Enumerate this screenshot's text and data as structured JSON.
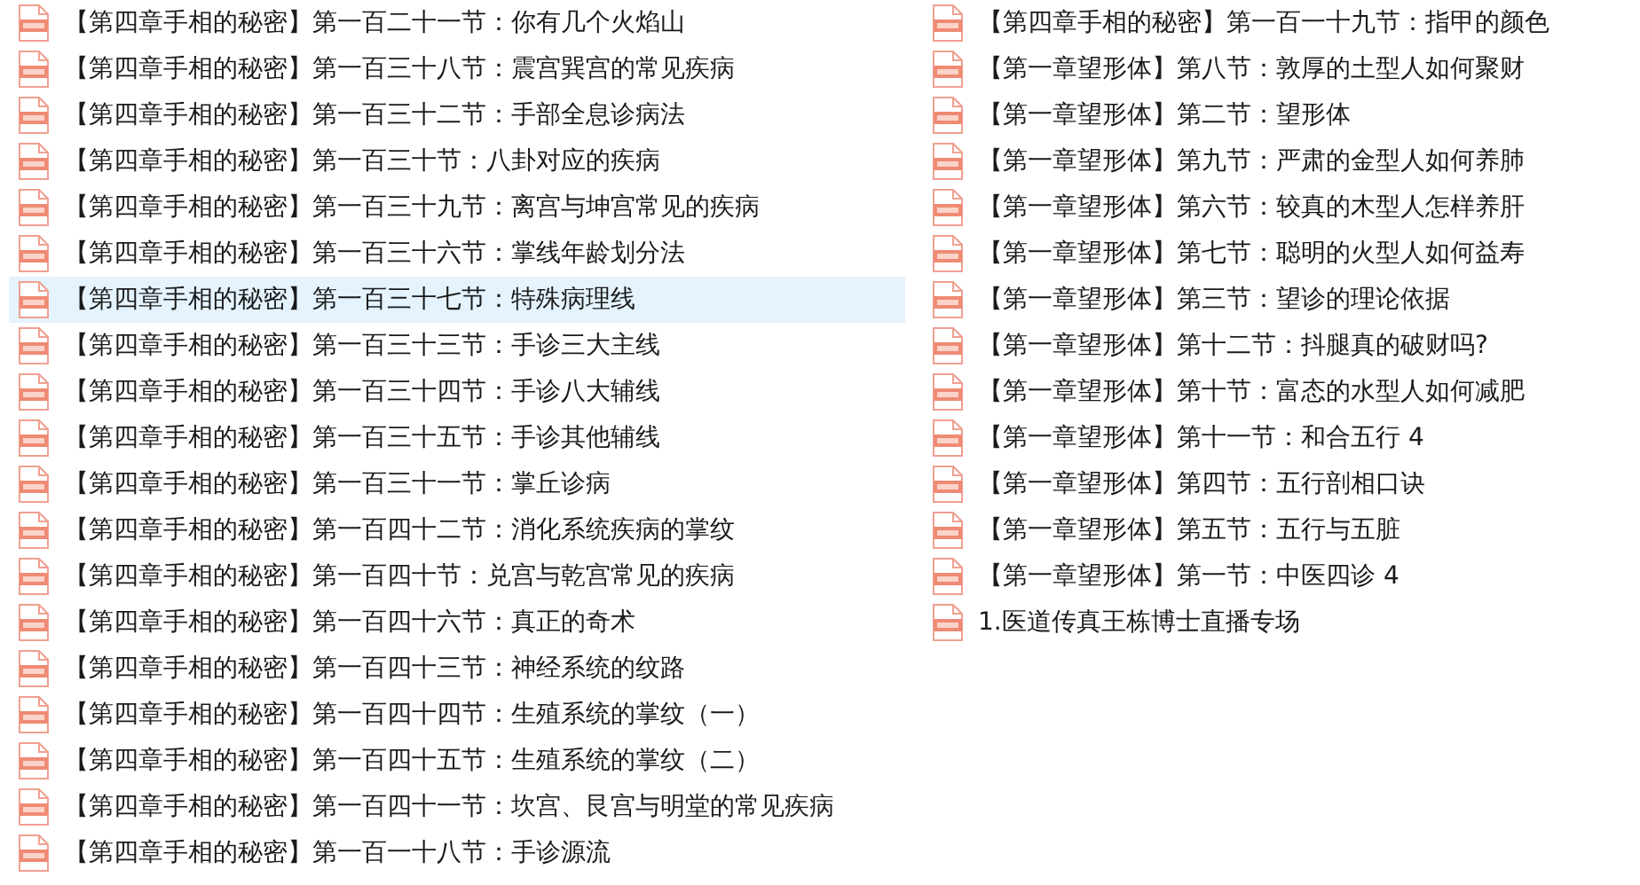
{
  "columns": [
    {
      "files": [
        {
          "name": "【第四章手相的秘密】第一百二十一节：你有几个火焰山",
          "selected": false
        },
        {
          "name": "【第四章手相的秘密】第一百三十八节：震宫巽宫的常见疾病",
          "selected": false
        },
        {
          "name": "【第四章手相的秘密】第一百三十二节：手部全息诊病法",
          "selected": false
        },
        {
          "name": "【第四章手相的秘密】第一百三十节：八卦对应的疾病",
          "selected": false
        },
        {
          "name": "【第四章手相的秘密】第一百三十九节：离宫与坤宫常见的疾病",
          "selected": false
        },
        {
          "name": "【第四章手相的秘密】第一百三十六节：掌线年龄划分法",
          "selected": false
        },
        {
          "name": "【第四章手相的秘密】第一百三十七节：特殊病理线",
          "selected": true
        },
        {
          "name": "【第四章手相的秘密】第一百三十三节：手诊三大主线",
          "selected": false
        },
        {
          "name": "【第四章手相的秘密】第一百三十四节：手诊八大辅线",
          "selected": false
        },
        {
          "name": "【第四章手相的秘密】第一百三十五节：手诊其他辅线",
          "selected": false
        },
        {
          "name": "【第四章手相的秘密】第一百三十一节：掌丘诊病",
          "selected": false
        },
        {
          "name": "【第四章手相的秘密】第一百四十二节：消化系统疾病的掌纹",
          "selected": false
        },
        {
          "name": "【第四章手相的秘密】第一百四十节：兑宫与乾宫常见的疾病",
          "selected": false
        },
        {
          "name": "【第四章手相的秘密】第一百四十六节：真正的奇术",
          "selected": false
        },
        {
          "name": "【第四章手相的秘密】第一百四十三节：神经系统的纹路",
          "selected": false
        },
        {
          "name": "【第四章手相的秘密】第一百四十四节：生殖系统的掌纹（一）",
          "selected": false
        },
        {
          "name": "【第四章手相的秘密】第一百四十五节：生殖系统的掌纹（二）",
          "selected": false
        },
        {
          "name": "【第四章手相的秘密】第一百四十一节：坎宫、艮宫与明堂的常见疾病",
          "selected": false
        },
        {
          "name": "【第四章手相的秘密】第一百一十八节：手诊源流",
          "selected": false
        }
      ]
    },
    {
      "files": [
        {
          "name": "【第四章手相的秘密】第一百一十九节：指甲的颜色",
          "selected": false
        },
        {
          "name": "【第一章望形体】第八节：敦厚的土型人如何聚财",
          "selected": false
        },
        {
          "name": "【第一章望形体】第二节：望形体",
          "selected": false
        },
        {
          "name": "【第一章望形体】第九节：严肃的金型人如何养肺",
          "selected": false
        },
        {
          "name": "【第一章望形体】第六节：较真的木型人怎样养肝",
          "selected": false
        },
        {
          "name": "【第一章望形体】第七节：聪明的火型人如何益寿",
          "selected": false
        },
        {
          "name": "【第一章望形体】第三节：望诊的理论依据",
          "selected": false
        },
        {
          "name": "【第一章望形体】第十二节：抖腿真的破财吗?",
          "selected": false
        },
        {
          "name": "【第一章望形体】第十节：富态的水型人如何减肥",
          "selected": false
        },
        {
          "name": "【第一章望形体】第十一节：和合五行 4",
          "selected": false
        },
        {
          "name": "【第一章望形体】第四节：五行剖相口诀",
          "selected": false
        },
        {
          "name": "【第一章望形体】第五节：五行与五脏",
          "selected": false
        },
        {
          "name": "【第一章望形体】第一节：中医四诊 4",
          "selected": false
        },
        {
          "name": "1.医道传真王栋博士直播专场",
          "selected": false
        }
      ]
    }
  ]
}
